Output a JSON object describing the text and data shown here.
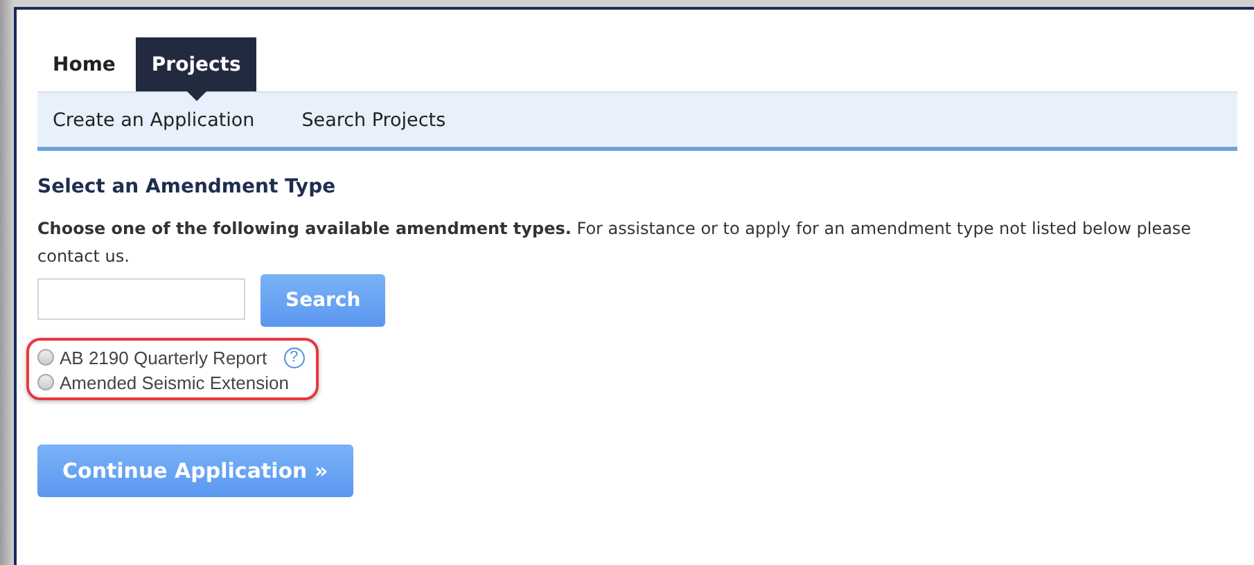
{
  "tabs": [
    {
      "label": "Home",
      "selected": false
    },
    {
      "label": "Projects",
      "selected": true
    }
  ],
  "subnav": [
    "Create an Application",
    "Search Projects"
  ],
  "heading": "Select an Amendment Type",
  "description": "**Choose one of the following available amendment types.** For assistance or to apply for an amendment type not listed below please contact us.",
  "search": {
    "button": "Search"
  },
  "options": [
    {
      "label": "AB 2190 Quarterly Report",
      "selected": false,
      "help": "?"
    },
    {
      "label": "Amended Seismic Extension",
      "selected": false
    }
  ],
  "continue_button": "Continue Application »"
}
